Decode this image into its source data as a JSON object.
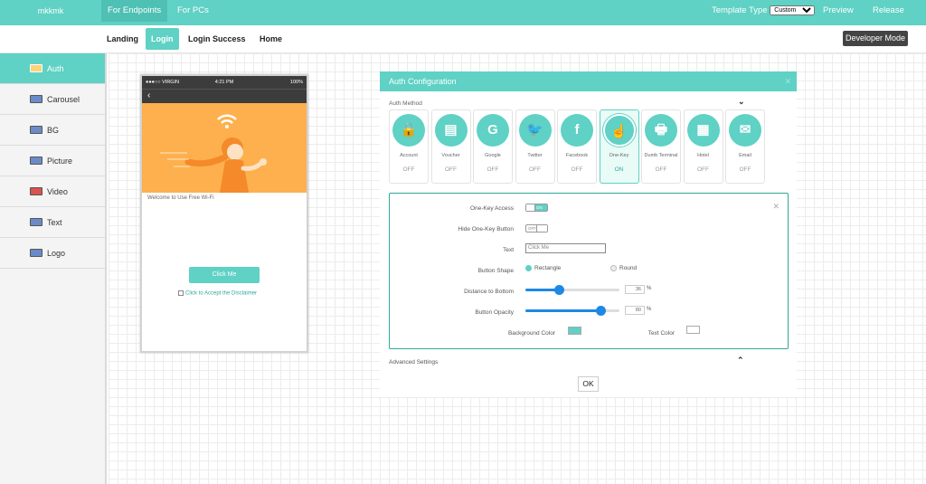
{
  "topbar": {
    "brand": "mkkmk",
    "tabs": [
      {
        "label": "For Endpoints"
      },
      {
        "label": "For PCs"
      }
    ],
    "template_type_label": "Template Type",
    "template_type_value": "Custom",
    "preview": "Preview",
    "release": "Release"
  },
  "subbar": {
    "tabs": [
      {
        "label": "Landing"
      },
      {
        "label": "Login"
      },
      {
        "label": "Login Success"
      },
      {
        "label": "Home"
      }
    ],
    "developer_mode": "Developer Mode"
  },
  "sidebar": {
    "items": [
      {
        "label": "Auth",
        "icon": "auth-icon"
      },
      {
        "label": "Carousel",
        "icon": "carousel-icon"
      },
      {
        "label": "BG",
        "icon": "bg-icon"
      },
      {
        "label": "Picture",
        "icon": "picture-icon"
      },
      {
        "label": "Video",
        "icon": "video-icon"
      },
      {
        "label": "Text",
        "icon": "text-icon"
      },
      {
        "label": "Logo",
        "icon": "logo-icon"
      }
    ]
  },
  "phone": {
    "carrier": "●●●○○ VIRGIN",
    "time": "4:21 PM",
    "battery": "100%",
    "back": "‹",
    "welcome": "Welcome to Use Free Wi-Fi",
    "button": "Click Me",
    "disclaimer": "Click to Accept the Disclaimer"
  },
  "panel": {
    "title": "Auth Configuration",
    "auth_method_label": "Auth Method",
    "methods": [
      {
        "name": "Account",
        "state": "OFF",
        "icon": "lock-icon",
        "glyph": "🔒"
      },
      {
        "name": "Voucher",
        "state": "OFF",
        "icon": "voucher-icon",
        "glyph": "▤"
      },
      {
        "name": "Google",
        "state": "OFF",
        "icon": "google-icon",
        "glyph": "G"
      },
      {
        "name": "Twitter",
        "state": "OFF",
        "icon": "twitter-icon",
        "glyph": "🐦"
      },
      {
        "name": "Facebook",
        "state": "OFF",
        "icon": "facebook-icon",
        "glyph": "f"
      },
      {
        "name": "One-Key",
        "state": "ON",
        "icon": "one-key-icon",
        "glyph": "☝"
      },
      {
        "name": "Dumb Terminal",
        "state": "OFF",
        "icon": "printer-icon",
        "glyph": "🖶"
      },
      {
        "name": "Hotel",
        "state": "OFF",
        "icon": "hotel-icon",
        "glyph": "▦"
      },
      {
        "name": "Email",
        "state": "OFF",
        "icon": "email-icon",
        "glyph": "✉"
      }
    ],
    "config": {
      "one_key_access_label": "One-Key Access",
      "one_key_access_state": "ON",
      "hide_button_label": "Hide One-Key Button",
      "hide_button_state": "OFF",
      "text_label": "Text",
      "text_value": "Click Me",
      "shape_label": "Button Shape",
      "shape_rectangle": "Rectangle",
      "shape_round": "Round",
      "distance_label": "Distance to Bottom",
      "distance_value": "36",
      "opacity_label": "Button Opacity",
      "opacity_value": "80",
      "percent": "%",
      "bg_color_label": "Background Color",
      "bg_color": "#5fd1c5",
      "text_color_label": "Text Color",
      "text_color": "#ffffff"
    },
    "advanced": "Advanced Settings",
    "ok": "OK"
  },
  "colors": {
    "accent": "#5fd1c5",
    "accent_dark": "#2ea89c",
    "slider": "#1e88e5",
    "hero": "#fdb04d"
  }
}
